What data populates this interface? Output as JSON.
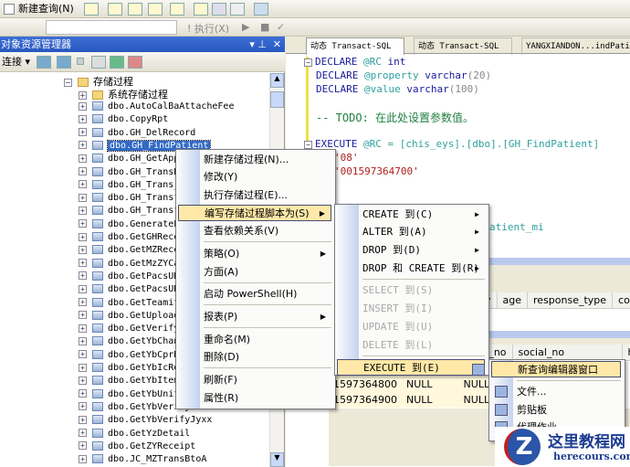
{
  "toolbar": {
    "new_query": "新建查询(N)",
    "execute": "! 执行(X)"
  },
  "object_explorer": {
    "title": "对象资源管理器",
    "connect": "连接 ▾",
    "tree": {
      "folder": "存储过程",
      "system_folder": "系统存储过程",
      "items": [
        "dbo.AutoCalBaAttacheFee",
        "dbo.CopyRpt",
        "dbo.GH_DelRecord",
        "dbo.GH_FindPatient",
        "dbo.GH_GetAppo",
        "dbo.GH_TransBC",
        "dbo.GH_Trans_m",
        "dbo.GH_Transfe",
        "dbo.GH_Transfe",
        "dbo.GeneratePa",
        "dbo.GetGHRecei",
        "dbo.GetMZRecei",
        "dbo.GetMzZYCar",
        "dbo.GetPacsURL",
        "dbo.GetPacsURL",
        "dbo.GetTeamite",
        "dbo.GetUploadD",
        "dbo.GetVerifyT",
        "dbo.GetYbChang",
        "dbo.GetYbCprDi",
        "dbo.GetYbIcReg",
        "dbo.GetYbItemI",
        "dbo.GetYbUnitM",
        "dbo.GetYbVerifyDetail",
        "dbo.GetYbVerifyJyxx",
        "dbo.GetYzDetail",
        "dbo.GetZYReceipt",
        "dbo.JC_MZTransBtoA"
      ]
    }
  },
  "tabs": [
    "动态 Transact-SQL",
    "动态 Transact-SQL",
    "YANGXIANDON...indPati"
  ],
  "code": {
    "l1a": "DECLARE",
    "l1b": "@RC",
    "l1c": "int",
    "l2a": "DECLARE",
    "l2b": "@property",
    "l2c": "varchar",
    "l2d": "(20)",
    "l3a": "DECLARE",
    "l3b": "@value",
    "l3c": "varchar",
    "l3d": "(100)",
    "l4": "-- TODO: 在此处设置参数值。",
    "l5a": "EXECUTE",
    "l5b": "@RC",
    "l5c": "= [chis_eys].[dbo].[GH_FindPatient]",
    "l6": "'08'",
    "l7": "'001597364700'",
    "l8": "atient_mi"
  },
  "grid1": {
    "headers": [
      "y",
      "age",
      "response_type",
      "contrac"
    ]
  },
  "grid2": {
    "headers": [
      "t_no",
      "social_no",
      "hic"
    ],
    "rows": [
      [
        "1597364800",
        "NULL",
        "NULL"
      ],
      [
        "1597364900",
        "NULL",
        "NULL"
      ]
    ]
  },
  "context_menu": {
    "items": [
      "新建存储过程(N)...",
      "修改(Y)",
      "执行存储过程(E)...",
      "编写存储过程脚本为(S)",
      "查看依赖关系(V)",
      "策略(O)",
      "方面(A)",
      "启动 PowerShell(H)",
      "报表(P)",
      "重命名(M)",
      "删除(D)",
      "刷新(F)",
      "属性(R)"
    ]
  },
  "script_menu": {
    "items": [
      "CREATE 到(C)",
      "ALTER 到(A)",
      "DROP 到(D)",
      "DROP 和 CREATE 到(R)",
      "SELECT 到(S)",
      "INSERT 到(I)",
      "UPDATE 到(U)",
      "DELETE 到(L)",
      "EXECUTE 到(E)"
    ]
  },
  "execute_menu": {
    "items": [
      "新查询编辑器窗口",
      "文件...",
      "剪贴板",
      "代理作业"
    ]
  },
  "watermark": {
    "title": "这里教程网",
    "url": "herecours.com"
  }
}
